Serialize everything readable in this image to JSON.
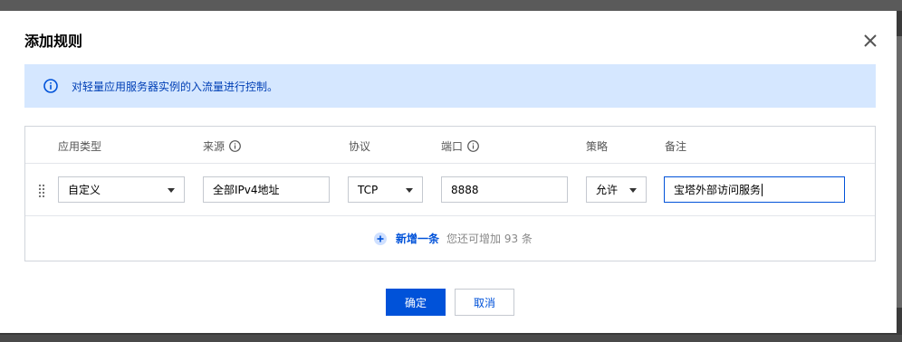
{
  "dialog": {
    "title": "添加规则",
    "notice": "对轻量应用服务器实例的入流量进行控制。"
  },
  "table": {
    "headers": {
      "app_type": "应用类型",
      "source": "来源",
      "protocol": "协议",
      "port": "端口",
      "policy": "策略",
      "remark": "备注"
    },
    "row": {
      "app_type": "自定义",
      "source": "全部IPv4地址",
      "protocol": "TCP",
      "port": "8888",
      "policy": "允许",
      "remark": "宝塔外部访问服务"
    },
    "add_label": "新增一条",
    "remaining_text": "您还可增加 93 条"
  },
  "footer": {
    "confirm_label": "确定",
    "cancel_label": "取消"
  },
  "colors": {
    "primary": "#0052d9",
    "notice_bg": "#d5e7ff",
    "notice_text": "#003fb5"
  }
}
